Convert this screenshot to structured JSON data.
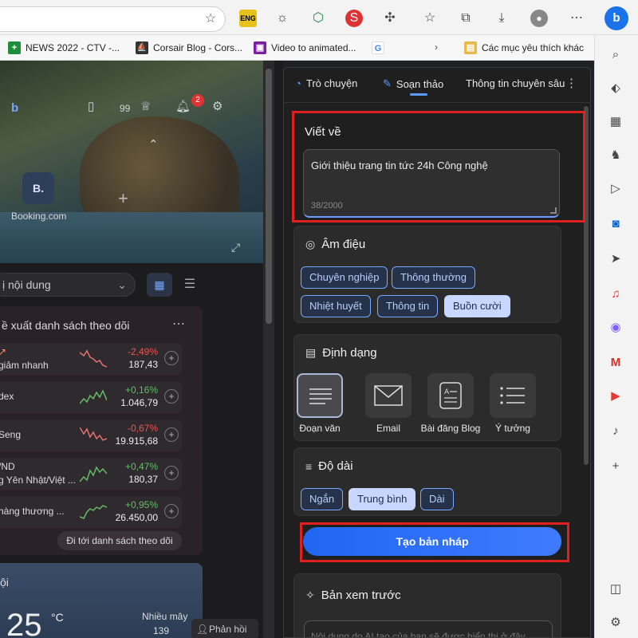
{
  "browser": {
    "star_icon": "star-plus-icon",
    "extensions": [
      "eng-icon",
      "sun-icon",
      "colorwheel-icon",
      "red-s-icon",
      "puzzle-icon",
      "favorites-icon",
      "collections-icon",
      "download-icon",
      "profile-icon"
    ],
    "bookmarks": [
      {
        "label": "NEWS 2022 - CTV -...",
        "color": "#1e8e3e",
        "glyph": "+"
      },
      {
        "label": "Corsair Blog - Cors...",
        "color": "#333333",
        "glyph": "⛵"
      },
      {
        "label": "Video to animated...",
        "color": "#7b1fa2",
        "glyph": "▣"
      },
      {
        "label": "",
        "color": "#ffffff",
        "glyph": "G"
      },
      {
        "label": "Các mục yêu thích khác",
        "color": "#e8b84b",
        "glyph": "▤"
      }
    ],
    "accent": "#1a73e8"
  },
  "ntp": {
    "badge_count": "2",
    "points": "99",
    "booking_tile_letter": "B.",
    "booking_label": "Booking.com",
    "dropdown_label": "ị nội dung",
    "watchlist_title": "ề xuất danh sách theo dõi",
    "stocks": [
      {
        "name1": "",
        "name2": "giảm nhanh",
        "change": "-2,49%",
        "value": "187,43",
        "dir": "down"
      },
      {
        "name1": "dex",
        "name2": "",
        "change": "+0,16%",
        "value": "1.046,79",
        "dir": "up"
      },
      {
        "name1": "Seng",
        "name2": "",
        "change": "-0,67%",
        "value": "19.915,68",
        "dir": "down"
      },
      {
        "name1": "/ND",
        "name2": "g Yên Nhật/Việt ...",
        "change": "+0,47%",
        "value": "180,37",
        "dir": "up"
      },
      {
        "name1": "",
        "name2": "hàng thương ...",
        "change": "+0,95%",
        "value": "26.450,00",
        "dir": "up"
      }
    ],
    "goto_label": "Đi tới danh sách theo dõi",
    "weather_loc": "ội",
    "weather_temp": "25",
    "weather_unit": "°C",
    "weather_more": "Nhiều mây",
    "weather_val": "139",
    "feedback_label": "Phản hồi"
  },
  "panel": {
    "tabs": [
      {
        "label": "Trò chuyện",
        "icon": "chat-icon"
      },
      {
        "label": "Soạn thảo",
        "icon": "compose-icon"
      },
      {
        "label": "Thông tin chuyên sâu",
        "icon": ""
      }
    ],
    "write_about": {
      "title": "Viết về",
      "text": "Giới thiệu trang tin tức 24h Công nghệ",
      "counter": "38/2000"
    },
    "tone": {
      "title": "Âm điệu",
      "options": [
        "Chuyên nghiệp",
        "Thông thường",
        "Nhiệt huyết",
        "Thông tin",
        "Buồn cười"
      ],
      "selected": "Buồn cười"
    },
    "format": {
      "title": "Định dạng",
      "options": [
        "Đoạn văn",
        "Email",
        "Bài đăng Blog",
        "Ý tưởng"
      ],
      "selected": "Đoạn văn"
    },
    "length": {
      "title": "Độ dài",
      "options": [
        "Ngắn",
        "Trung bình",
        "Dài"
      ],
      "selected": "Trung bình"
    },
    "generate_label": "Tạo bản nháp",
    "preview": {
      "title": "Bản xem trước",
      "placeholder": "Nội dung do AI tạo của bạn sẽ được hiển thị ở đây"
    },
    "highlight_color": "#e01f1f",
    "accent": "#5b9bff"
  }
}
